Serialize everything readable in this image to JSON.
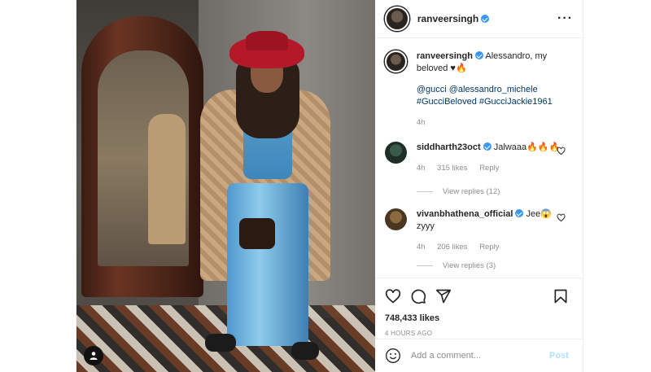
{
  "post": {
    "author": "ranveersingh",
    "verified": true,
    "more_icon": "more-horizontal-icon",
    "caption": {
      "username": "ranveersingh",
      "text": "Alessandro, my beloved ♥🔥",
      "tags": "@gucci @alessandro_michele #GucciBeloved #GucciJackie1961",
      "time": "4h"
    },
    "comments": [
      {
        "username": "siddharth23oct",
        "text": "Jalwaaa🔥🔥🔥",
        "time": "4h",
        "likes": "315 likes",
        "reply": "Reply",
        "view_replies": "View replies (12)"
      },
      {
        "username": "vivanbhathena_official",
        "text": "Jee😱zyyy",
        "time": "4h",
        "likes": "206 likes",
        "reply": "Reply",
        "view_replies": "View replies (3)"
      }
    ],
    "likes": "748,433 likes",
    "posted_ago": "4 HOURS AGO",
    "add_comment_placeholder": "Add a comment...",
    "post_label": "Post",
    "icons": [
      "heart-icon",
      "comment-icon",
      "share-icon",
      "bookmark-icon",
      "emoji-icon",
      "user-tag-icon"
    ],
    "colors": {
      "link": "#00376b",
      "verified": "#3897f0",
      "post_button": "#b2dffc",
      "muted": "#8e8e8e"
    }
  }
}
